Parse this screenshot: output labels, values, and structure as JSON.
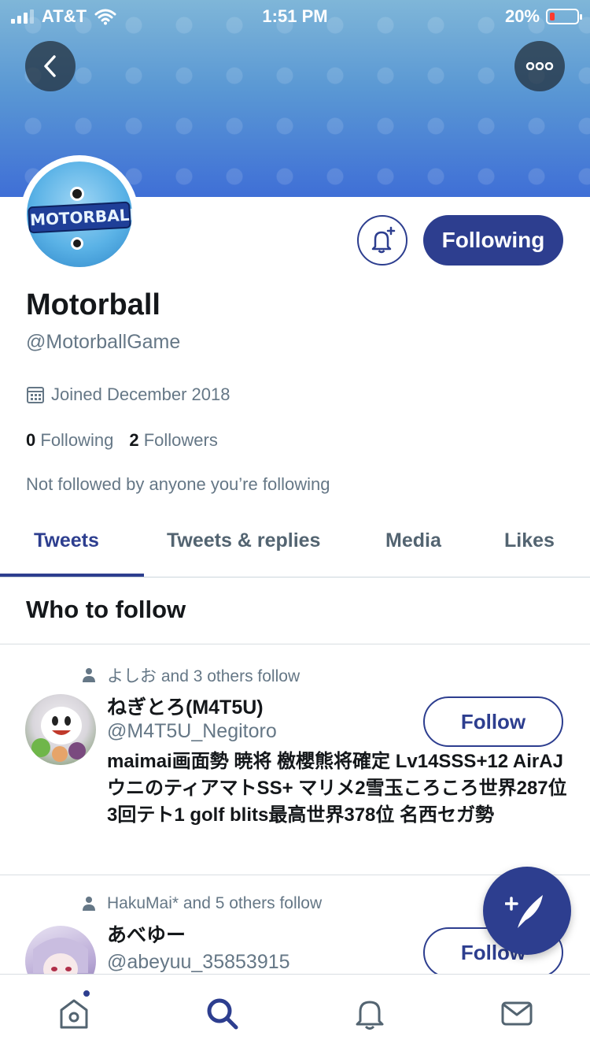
{
  "status_bar": {
    "carrier": "AT&T",
    "time": "1:51 PM",
    "battery_percent": "20%"
  },
  "header": {
    "back_icon": "chevron-left-icon",
    "more_icon": "more-icon"
  },
  "profile": {
    "logo_text": "MOTORBALL",
    "name": "Motorball",
    "handle": "@MotorballGame",
    "joined": "Joined December 2018",
    "following_count": "0",
    "following_label": "Following",
    "followers_count": "2",
    "followers_label": "Followers",
    "not_followed": "Not followed by anyone you’re following",
    "following_button": "Following",
    "notify_icon": "bell-plus-icon"
  },
  "tabs": [
    {
      "label": "Tweets",
      "active": true
    },
    {
      "label": "Tweets & replies",
      "active": false
    },
    {
      "label": "Media",
      "active": false
    },
    {
      "label": "Likes",
      "active": false
    }
  ],
  "who_to_follow": {
    "title": "Who to follow",
    "suggestions": [
      {
        "context": "よしお and 3 others follow",
        "name": "ねぎとろ(M4T5U)",
        "handle": "@M4T5U_Negitoro",
        "bio": "maimai画面勢 暁将 檄櫻熊将確定 Lv14SSS+12 AirAJ ウニのティアマトSS+ マリメ2雪玉ころころ世界287位 3回テト1 golf blits最高世界378位 名西セガ勢",
        "button": "Follow"
      },
      {
        "context": "HakuMai* and 5 others follow",
        "name": "あべゆー",
        "handle": "@abeyuu_35853915",
        "bio": "",
        "button": "Follow"
      }
    ]
  },
  "bottom_nav": [
    {
      "icon": "home-icon",
      "active": false,
      "badge": true
    },
    {
      "icon": "search-icon",
      "active": true,
      "badge": false
    },
    {
      "icon": "bell-icon",
      "active": false,
      "badge": false
    },
    {
      "icon": "mail-icon",
      "active": false,
      "badge": false
    }
  ],
  "colors": {
    "accent": "#2d3e8f",
    "secondary_text": "#657786"
  }
}
